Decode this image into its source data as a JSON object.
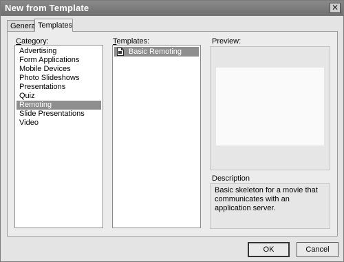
{
  "window": {
    "title": "New from Template",
    "close_glyph": "✕"
  },
  "tabs": [
    {
      "label": "General",
      "selected": false
    },
    {
      "label": "Templates",
      "selected": true
    }
  ],
  "category": {
    "label_accel": "C",
    "label_rest": "ategory:",
    "items": [
      "Advertising",
      "Form Applications",
      "Mobile Devices",
      "Photo Slideshows",
      "Presentations",
      "Quiz",
      "Remoting",
      "Slide Presentations",
      "Video"
    ],
    "selected": "Remoting"
  },
  "templates": {
    "label_accel": "T",
    "label_rest": "emplates:",
    "items": [
      {
        "label": "Basic Remoting",
        "icon": "document-icon",
        "selected": true
      }
    ]
  },
  "preview": {
    "label": "Preview:"
  },
  "description": {
    "label": "Description",
    "text": "Basic skeleton for a movie that communicates with an application server."
  },
  "buttons": {
    "ok": "OK",
    "cancel": "Cancel"
  }
}
